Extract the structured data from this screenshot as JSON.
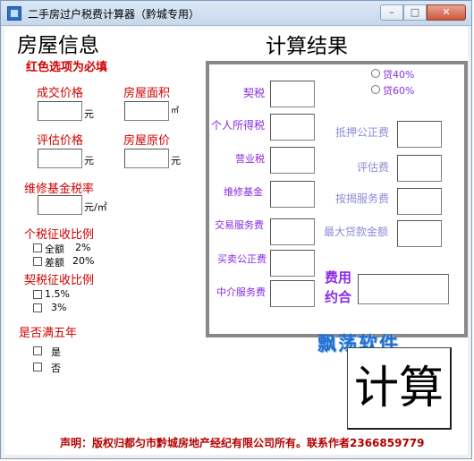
{
  "window": {
    "title": "二手房过户税费计算器（黔城专用）",
    "minimize_symbol": "–",
    "maximize_symbol": "□",
    "close_symbol": "✕"
  },
  "left": {
    "heading": "房屋信息",
    "required_note": "红色选项为必填",
    "deal_price_label": "成交价格",
    "deal_price_unit": "元",
    "house_area_label": "房屋面积",
    "house_area_unit": "㎡",
    "assess_price_label": "评估价格",
    "assess_price_unit": "元",
    "original_price_label": "房屋原价",
    "original_price_unit": "元",
    "maint_fund_label": "维修基金税率",
    "maint_fund_unit": "元/㎡",
    "income_tax_ratio_label": "个税征收比例",
    "income_tax_opt1_label": "全额",
    "income_tax_opt1_value": "2%",
    "income_tax_opt2_label": "差额",
    "income_tax_opt2_value": "20%",
    "deed_tax_ratio_label": "契税征收比例",
    "deed_tax_opt1": "1.5%",
    "deed_tax_opt2": "3%",
    "five_years_label": "是否满五年",
    "five_years_yes": "是",
    "five_years_no": "否"
  },
  "right": {
    "heading": "计算结果",
    "loan40_label": "贷40%",
    "loan60_label": "贷60%",
    "deed_tax_label": "契税",
    "personal_income_tax_label": "个人所得税",
    "business_tax_label": "营业税",
    "maint_fund_label": "维修基金",
    "trade_service_fee_label": "交易服务费",
    "sale_notary_fee_label": "买卖公正费",
    "agency_fee_label": "中介服务费",
    "mortgage_notary_fee_label": "抵押公正费",
    "assess_fee_label": "评估费",
    "mortgage_service_fee_label": "按揭服务费",
    "max_loan_label": "最大贷款金额",
    "total_fee_label_line1": "费用",
    "total_fee_label_line2": "约合"
  },
  "watermark": "飘荡软件",
  "calc_button_label": "计算",
  "footer": "声明：版权归都匀市黔城房地产经纪有限公司所有。联系作者2366859779"
}
